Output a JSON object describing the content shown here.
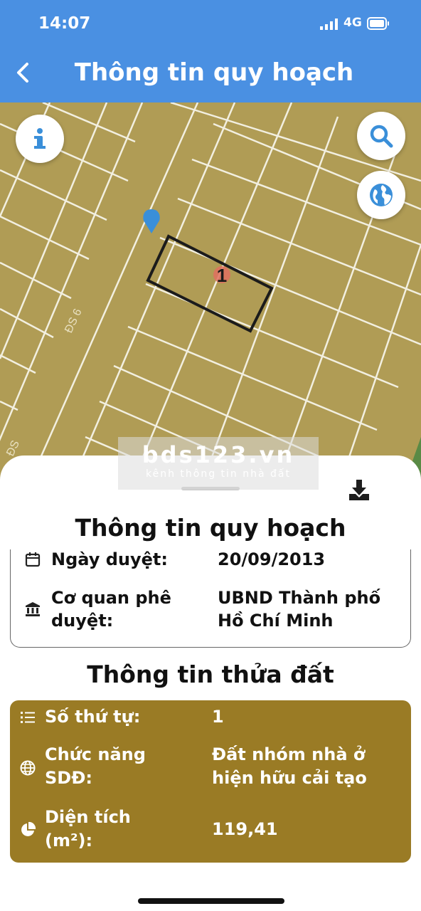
{
  "status_bar": {
    "time": "14:07",
    "network": "4G"
  },
  "header": {
    "title": "Thông tin quy hoạch"
  },
  "map": {
    "parcel_label": "1",
    "road_label_1": "ĐS 6",
    "road_label_2": "ĐS",
    "colors": {
      "land": "#b09c55",
      "lines": "#f2efe0",
      "parcel_border": "#1b1b1b",
      "marker": "#3a8fd9"
    }
  },
  "watermark": {
    "brand": "bds123.vn",
    "tagline": "kênh thông tin nhà đất"
  },
  "plan_info": {
    "heading": "Thông tin quy hoạch",
    "approval_date_label": "Ngày duyệt:",
    "approval_date_value": "20/09/2013",
    "agency_label_line1": "Cơ quan phê",
    "agency_label_line2": "duyệt:",
    "agency_value_line1": "UBND Thành phố",
    "agency_value_line2": "Hồ Chí Minh"
  },
  "parcel_info": {
    "heading": "Thông tin thửa đất",
    "order_label": "Số thứ tự:",
    "order_value": "1",
    "function_label_line1": "Chức năng",
    "function_label_line2": "SDĐ:",
    "function_value_line1": "Đất nhóm nhà ở",
    "function_value_line2": "hiện hữu cải tạo",
    "area_label_line1": "Diện tích",
    "area_label_line2": "(m²):",
    "area_value": "119,41",
    "card_color": "#9a7b25"
  }
}
